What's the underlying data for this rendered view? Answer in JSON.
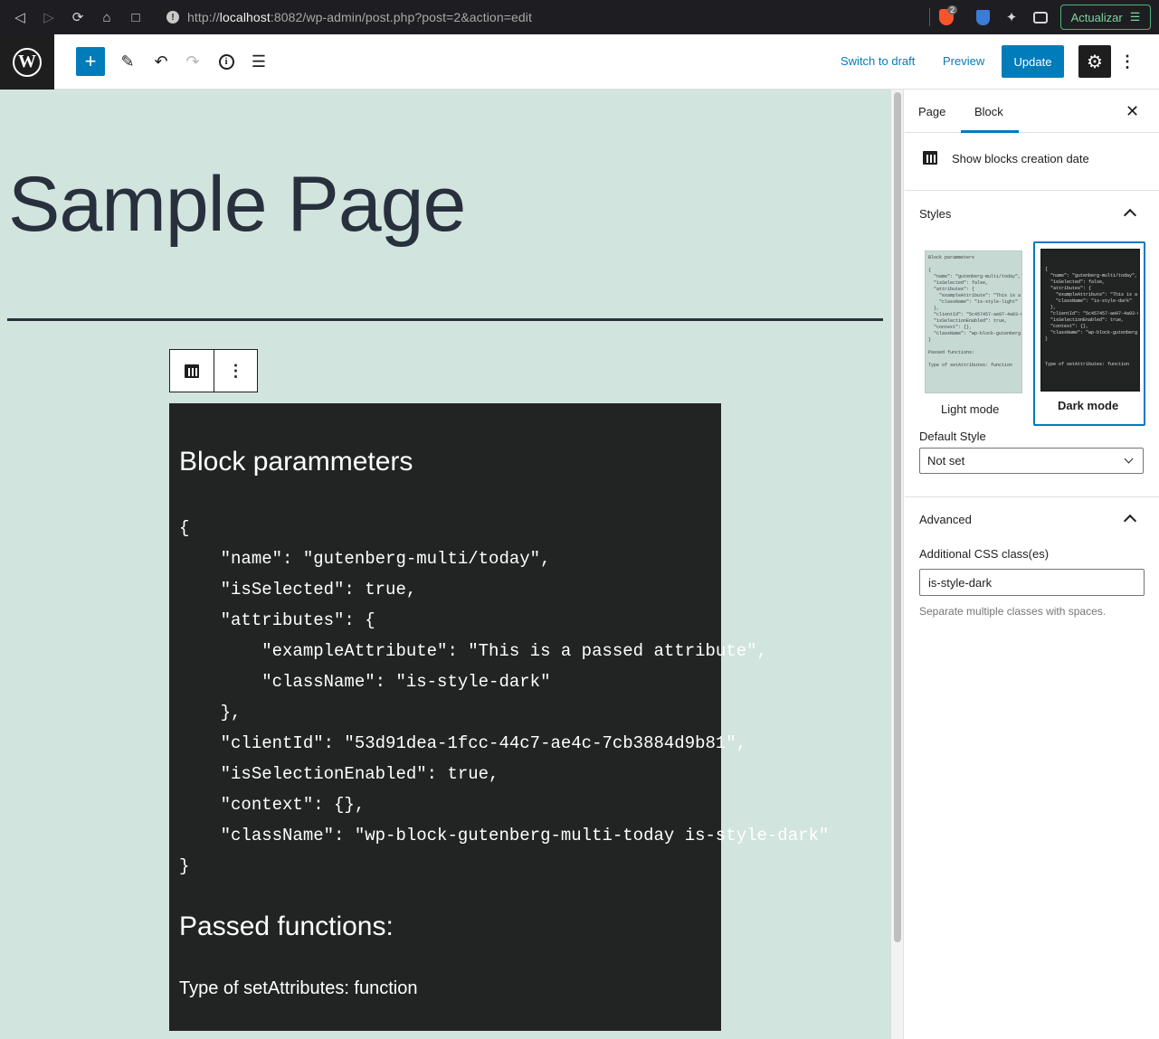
{
  "browser": {
    "url_host": "localhost",
    "url_prefix": "http://",
    "url_rest": ":8082/wp-admin/post.php?post=2&action=edit",
    "shields_badge": "2",
    "update_label": "Actualizar",
    "icons": [
      "back-icon",
      "forward-icon",
      "reload-icon",
      "home-icon",
      "bookmark-icon",
      "info-icon",
      "brave-shield-icon",
      "bitwarden-icon",
      "extensions-icon",
      "wallet-icon",
      "menu-icon"
    ]
  },
  "toolbar": {
    "switch_draft": "Switch to draft",
    "preview": "Preview",
    "update": "Update",
    "accent": "#007cba"
  },
  "canvas": {
    "background": "#d1e4dd",
    "page_title": "Sample Page",
    "block": {
      "heading": "Block parammeters",
      "code": "{\n    \"name\": \"gutenberg-multi/today\",\n    \"isSelected\": true,\n    \"attributes\": {\n        \"exampleAttribute\": \"This is a passed attribute\",\n        \"className\": \"is-style-dark\"\n    },\n    \"clientId\": \"53d91dea-1fcc-44c7-ae4c-7cb3884d9b81\",\n    \"isSelectionEnabled\": true,\n    \"context\": {},\n    \"className\": \"wp-block-gutenberg-multi-today is-style-dark\"\n}",
      "functions_heading": "Passed functions:",
      "functions_text": "Type of setAttributes: function"
    }
  },
  "sidebar": {
    "tab_page": "Page",
    "tab_block": "Block",
    "show_created": "Show blocks creation date",
    "styles_title": "Styles",
    "style_light_label": "Light mode",
    "style_dark_label": "Dark mode",
    "light_thumb": "Block parammeters\n\n{\n  \"name\": \"gutenberg-multi/today\",\n  \"isSelected\": false,\n  \"attributes\": {\n    \"exampleAttribute\": \"This is a p\n    \"className\": \"is-style-light\"\n  },\n  \"clientId\": \"5c457457-ae07-4a03-96ee\n  \"isSelectionEnabled\": true,\n  \"context\": {},\n  \"className\": \"wp-block-gutenberg-mult\n}\n\nPassed functions:\n\nType of setAttributes: function",
    "dark_thumb": "\n\n{\n  \"name\": \"gutenberg-multi/today\",\n  \"isSelected\": false,\n  \"attributes\": {\n    \"exampleAttribute\": \"This is a p\n    \"className\": \"is-style-dark\"\n  },\n  \"clientId\": \"5c457457-ae07-4a03-96ee\n  \"isSelectionEnabled\": true,\n  \"context\": {},\n  \"className\": \"wp-block-gutenberg-mult\n}\n\n\n\nType of setAttributes: function",
    "default_style_label": "Default Style",
    "default_style_value": "Not set",
    "advanced_title": "Advanced",
    "css_label": "Additional CSS class(es)",
    "css_value": "is-style-dark",
    "css_help": "Separate multiple classes with spaces."
  }
}
